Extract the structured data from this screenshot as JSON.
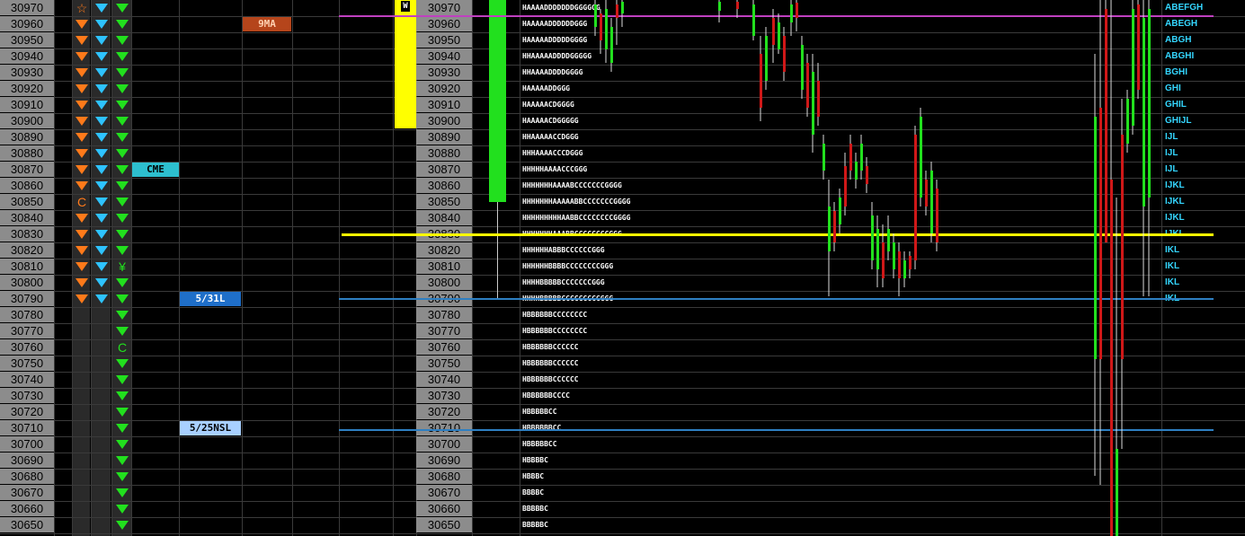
{
  "prices": [
    "30970",
    "30960",
    "30950",
    "30940",
    "30930",
    "30920",
    "30910",
    "30900",
    "30890",
    "30880",
    "30870",
    "30860",
    "30850",
    "30840",
    "30830",
    "30820",
    "30810",
    "30800",
    "30790",
    "30780",
    "30770",
    "30760",
    "30750",
    "30740",
    "30730",
    "30720",
    "30710",
    "30700",
    "30690",
    "30680",
    "30670",
    "30660",
    "30650"
  ],
  "col1_icons": [
    "star",
    "tri",
    "tri",
    "tri",
    "tri",
    "tri",
    "tri",
    "tri",
    "tri",
    "tri",
    "tri",
    "tri",
    "C",
    "tri",
    "tri",
    "tri",
    "tri",
    "tri",
    "tri",
    "",
    "",
    "",
    "",
    "",
    "",
    "",
    "",
    "",
    "",
    "",
    "",
    "",
    ""
  ],
  "col2_icons": [
    "tri",
    "tri",
    "tri",
    "tri",
    "tri",
    "tri",
    "tri",
    "tri",
    "tri",
    "tri",
    "tri",
    "tri",
    "tri",
    "tri",
    "tri",
    "tri",
    "tri",
    "tri",
    "tri",
    "",
    "",
    "",
    "",
    "",
    "",
    "",
    "",
    "",
    "",
    "",
    "",
    "",
    ""
  ],
  "col3_icons": [
    "tri",
    "tri",
    "tri",
    "tri",
    "tri",
    "tri",
    "tri",
    "tri",
    "tri",
    "tri",
    "tri",
    "tri",
    "tri",
    "tri",
    "tri",
    "tri",
    "yen",
    "tri",
    "tri",
    "tri",
    "tri",
    "C",
    "tri",
    "tri",
    "tri",
    "tri",
    "tri",
    "tri",
    "tri",
    "tri",
    "tri",
    "tri",
    "tri"
  ],
  "labels": {
    "cme": "CME",
    "nine_ma": "9MA",
    "level_531": "5/31L",
    "level_525": "5/25NSL",
    "marker_w": "W"
  },
  "tpo_rows": [
    "HAAAADDDDDDDGGGGGG",
    "HAAAAADDDDDDGGG",
    "HAAAAADDDDDGGGG",
    "HHAAAAADDDDGGGGG",
    "HHAAAADDDDGGGG",
    "HAAAAADDGGG",
    "HAAAAACDGGGG",
    "HAAAAACDGGGGG",
    "HHAAAAACCDGGG",
    "HHHAAAACCCDGGG",
    "HHHHHAAAACCCGGG",
    "HHHHHHHAAAABCCCCCCCGGGG",
    "HHHHHHHAAAAABBCCCCCCCGGGG",
    "HHHHHHHHHAABBCCCCCCCCGGGG",
    "HHHHHHHAAABBCCCCCCCCGGG",
    "HHHHHHABBBCCCCCCGGG",
    "HHHHHHBBBBCCCCCCCCGGG",
    "HHHHBBBBBCCCCCCCGGG",
    "HHHHBBBBBCCCCCCCCCGGG",
    "HBBBBBBCCCCCCCC",
    "HBBBBBBCCCCCCCC",
    "HBBBBBBCCCCCC",
    "HBBBBBBCCCCCC",
    "HBBBBBBCCCCCC",
    "HBBBBBBCCCC",
    "HBBBBBCC",
    "HBBBBBBCC",
    "HBBBBBCC",
    "HBBBBC",
    "HBBBC",
    "BBBBC",
    "BBBBBC",
    "BBBBBC"
  ],
  "right_labels": [
    "ABEFGH",
    "ABEGH",
    "ABGH",
    "ABGHI",
    "BGHI",
    "GHI",
    "GHIL",
    "GHIJL",
    "IJL",
    "IJL",
    "IJL",
    "IJKL",
    "IJKL",
    "IJKL",
    "IJKL",
    "IKL",
    "IKL",
    "IKL",
    "IKL",
    "",
    "",
    "",
    "",
    "",
    "",
    "",
    "",
    "",
    "",
    "",
    "",
    "",
    ""
  ],
  "colors": {
    "orange": "#ff7a1a",
    "cyan": "#2ec3ff",
    "green": "#22e01e",
    "yellow": "#ffff00",
    "magenta": "#c040c0",
    "blue_line": "#2e7fc2"
  }
}
